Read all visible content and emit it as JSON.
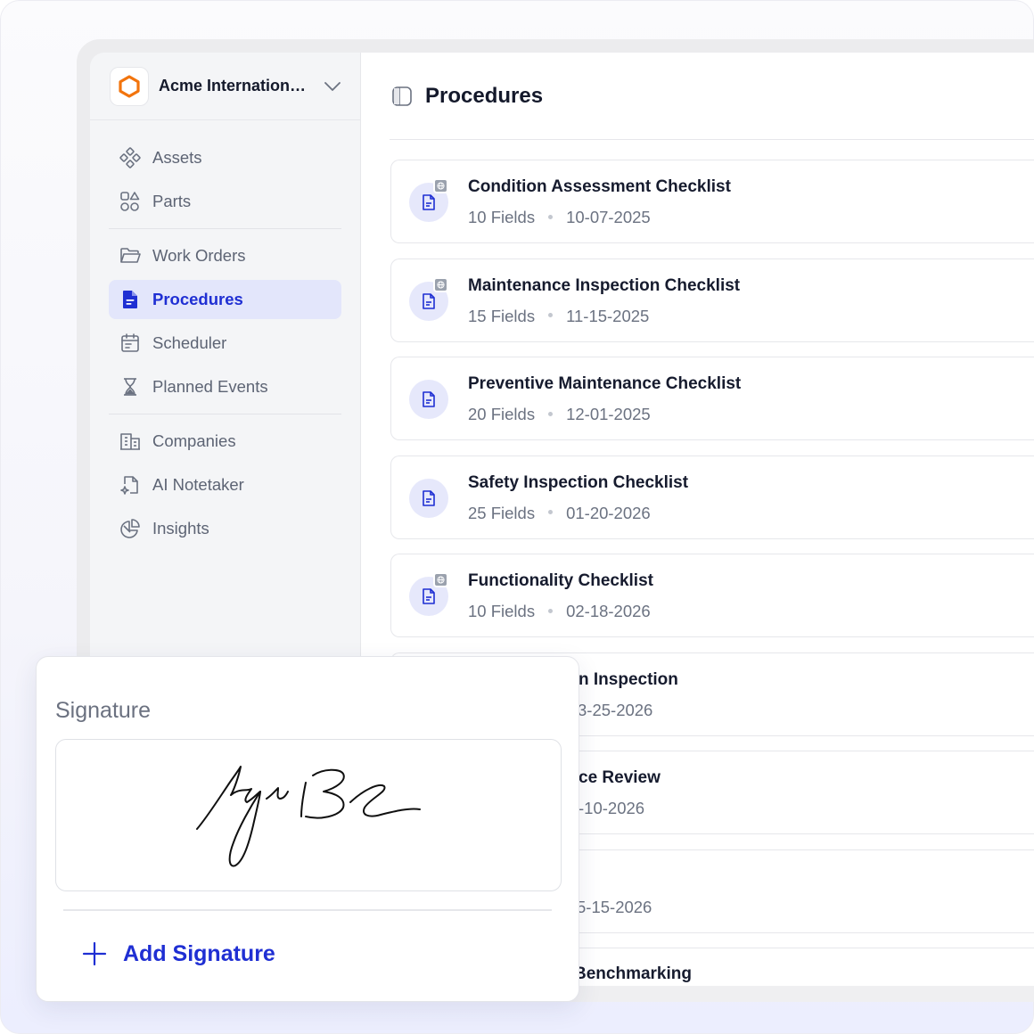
{
  "org": {
    "name": "Acme International Group"
  },
  "sidebar": {
    "groups": [
      [
        {
          "label": "Assets",
          "icon": "assets-icon"
        },
        {
          "label": "Parts",
          "icon": "parts-icon"
        }
      ],
      [
        {
          "label": "Work Orders",
          "icon": "folder-icon"
        },
        {
          "label": "Procedures",
          "icon": "document-icon",
          "active": true
        },
        {
          "label": "Scheduler",
          "icon": "calendar-icon"
        },
        {
          "label": "Planned Events",
          "icon": "hourglass-icon"
        }
      ],
      [
        {
          "label": "Companies",
          "icon": "building-icon"
        },
        {
          "label": "AI Notetaker",
          "icon": "ai-notetaker-icon"
        },
        {
          "label": "Insights",
          "icon": "pie-chart-icon"
        }
      ]
    ]
  },
  "main": {
    "title": "Procedures",
    "procedures": [
      {
        "title": "Condition Assessment Checklist",
        "fields": "10 Fields",
        "date": "10-07-2025",
        "globe": true
      },
      {
        "title": "Maintenance Inspection Checklist",
        "fields": "15 Fields",
        "date": "11-15-2025",
        "globe": true
      },
      {
        "title": "Preventive Maintenance Checklist",
        "fields": "20 Fields",
        "date": "12-01-2025",
        "globe": false
      },
      {
        "title": "Safety Inspection Checklist",
        "fields": "25 Fields",
        "date": "01-20-2026",
        "globe": false
      },
      {
        "title": "Functionality Checklist",
        "fields": "10 Fields",
        "date": "02-18-2026",
        "globe": true
      },
      {
        "title": "n Inspection",
        "fields": "",
        "date": "3-25-2026",
        "globe": false
      },
      {
        "title": "ce Review",
        "fields": "",
        "date": "-10-2026",
        "globe": false
      },
      {
        "title": "",
        "fields": "",
        "date": "5-15-2026",
        "globe": false
      },
      {
        "title": "Benchmarking",
        "fields": "",
        "date": "",
        "globe": false
      }
    ]
  },
  "signature_panel": {
    "label": "Signature",
    "add_label": "Add Signature"
  },
  "colors": {
    "accent": "#1f2fd3",
    "brand_orange": "#f2740d",
    "active_bg": "#e3e6fb"
  }
}
